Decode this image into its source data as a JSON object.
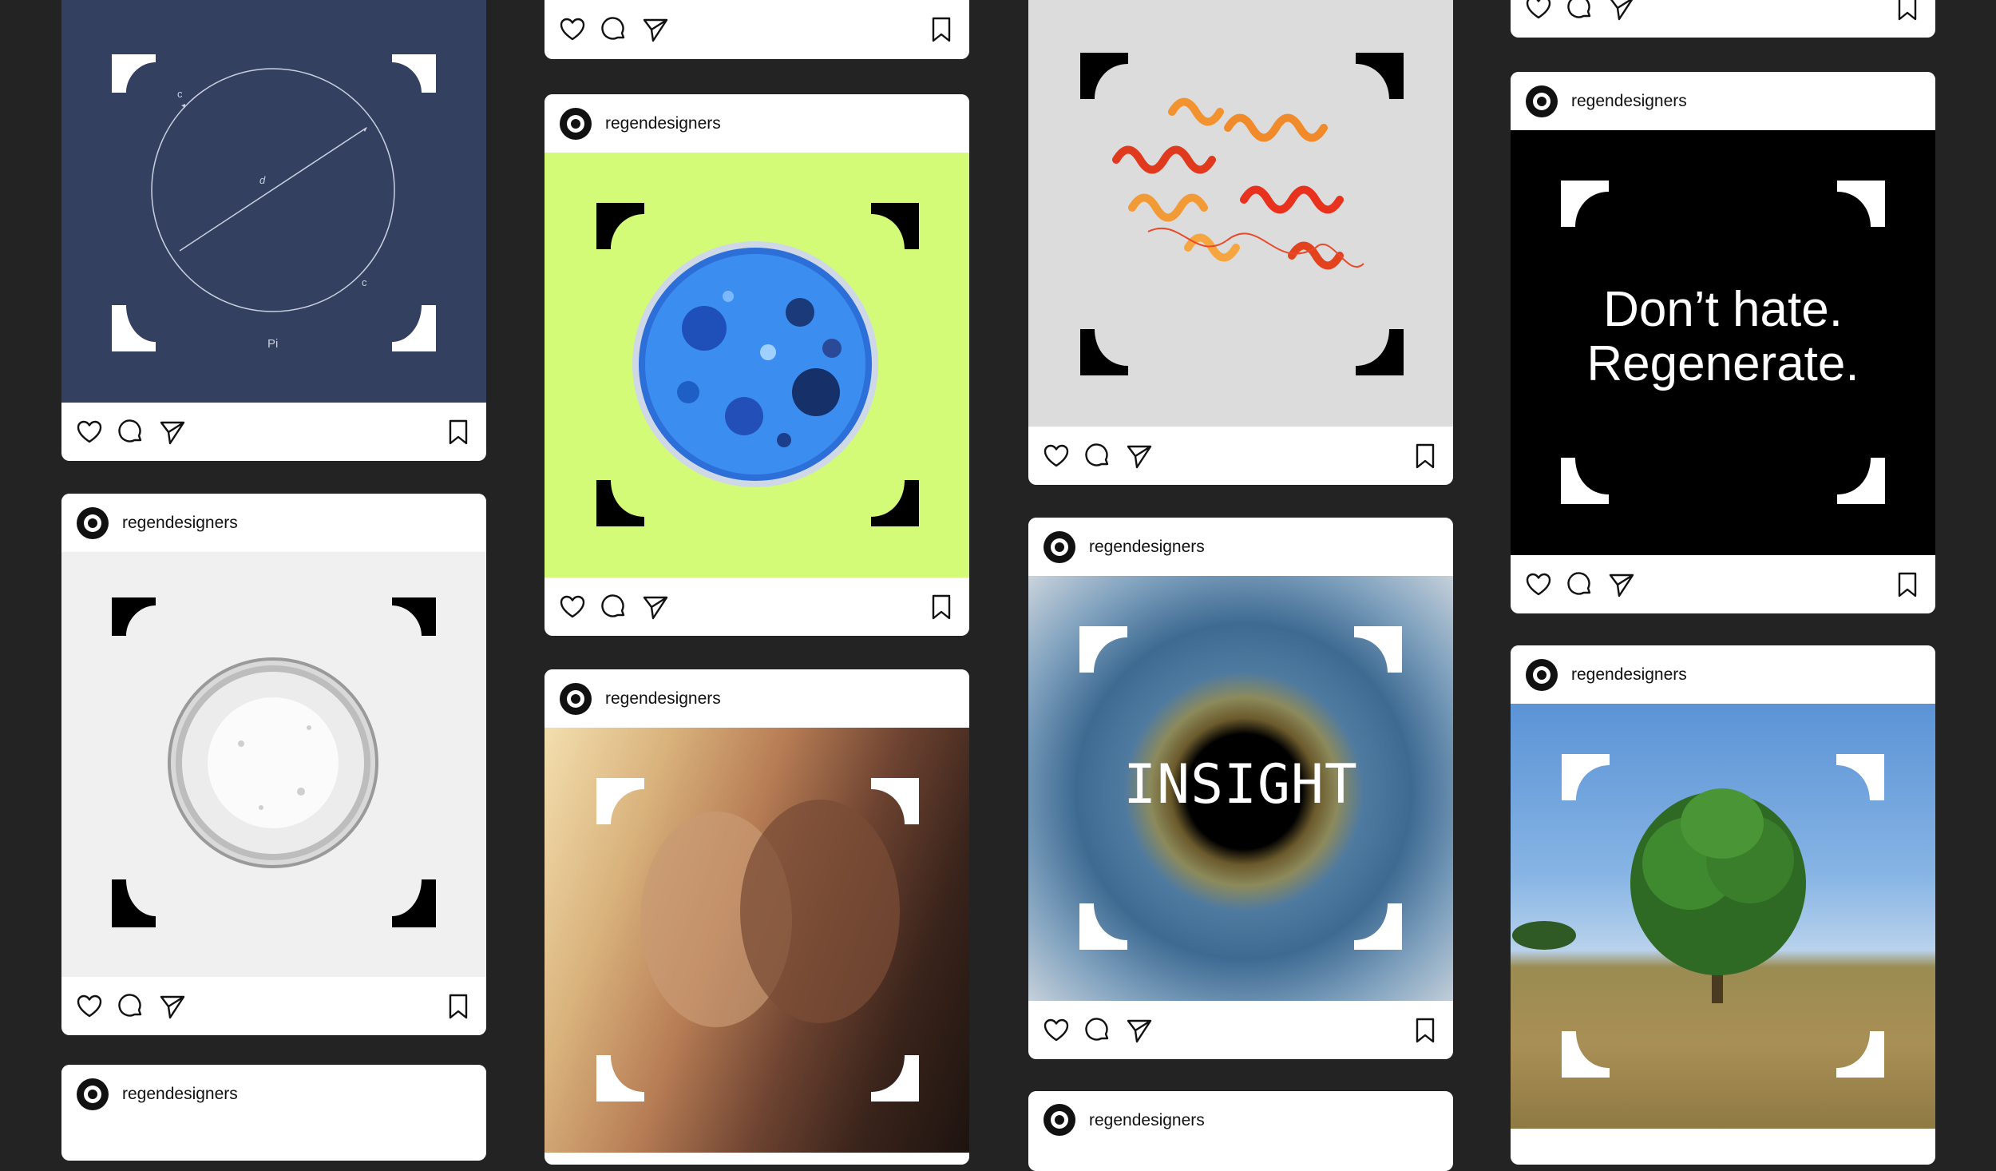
{
  "username": "regendesigners",
  "posts": [
    {
      "caption_lines": [
        "Don’t hate.",
        "Regenerate."
      ]
    },
    {
      "caption": "INSIGHT"
    },
    {
      "diagram": {
        "labels": [
          "c",
          "d",
          "c",
          "Pi"
        ]
      }
    }
  ],
  "icons": {
    "like": "heart-icon",
    "comment": "comment-icon",
    "share": "send-icon",
    "save": "bookmark-icon",
    "avatar": "regen-logo-icon"
  },
  "colors": {
    "background": "#232323",
    "card": "#ffffff",
    "navy": "#334060",
    "lime": "#d4fb78",
    "light_gray": "#f0f0f0",
    "protein_bg": "#dcdcdc",
    "black": "#000000"
  }
}
